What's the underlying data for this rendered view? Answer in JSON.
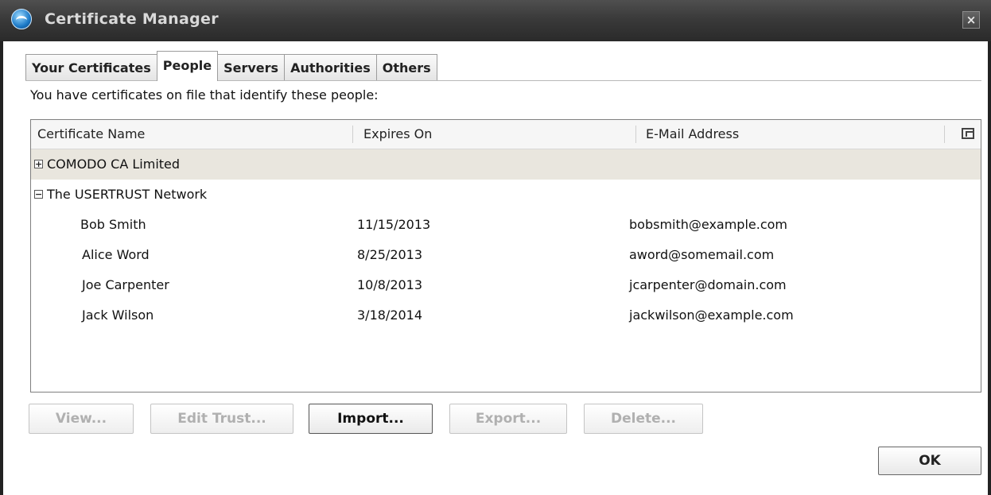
{
  "window": {
    "title": "Certificate Manager",
    "close_glyph": "×"
  },
  "tabs": [
    {
      "label": "Your Certificates",
      "active": false
    },
    {
      "label": "People",
      "active": true
    },
    {
      "label": "Servers",
      "active": false
    },
    {
      "label": "Authorities",
      "active": false
    },
    {
      "label": "Others",
      "active": false
    }
  ],
  "description": "You have certificates on file that identify these people:",
  "table": {
    "columns": [
      "Certificate Name",
      "Expires On",
      "E-Mail Address"
    ],
    "groups": [
      {
        "name": "COMODO CA Limited",
        "expanded": false,
        "expander": "+"
      },
      {
        "name": "The USERTRUST Network",
        "expanded": true,
        "expander": "−"
      }
    ],
    "rows": [
      {
        "name": "Bob Smith",
        "expires": "11/15/2013",
        "email": "bobsmith@example.com"
      },
      {
        "name": "Alice Word",
        "expires": "8/25/2013",
        "email": "aword@somemail.com"
      },
      {
        "name": "Joe Carpenter",
        "expires": "10/8/2013",
        "email": "jcarpenter@domain.com"
      },
      {
        "name": "Jack Wilson",
        "expires": "3/18/2014",
        "email": "jackwilson@example.com"
      }
    ]
  },
  "buttons": {
    "view": "View...",
    "edit_trust": "Edit Trust...",
    "import": "Import...",
    "export": "Export...",
    "delete": "Delete...",
    "ok": "OK"
  }
}
